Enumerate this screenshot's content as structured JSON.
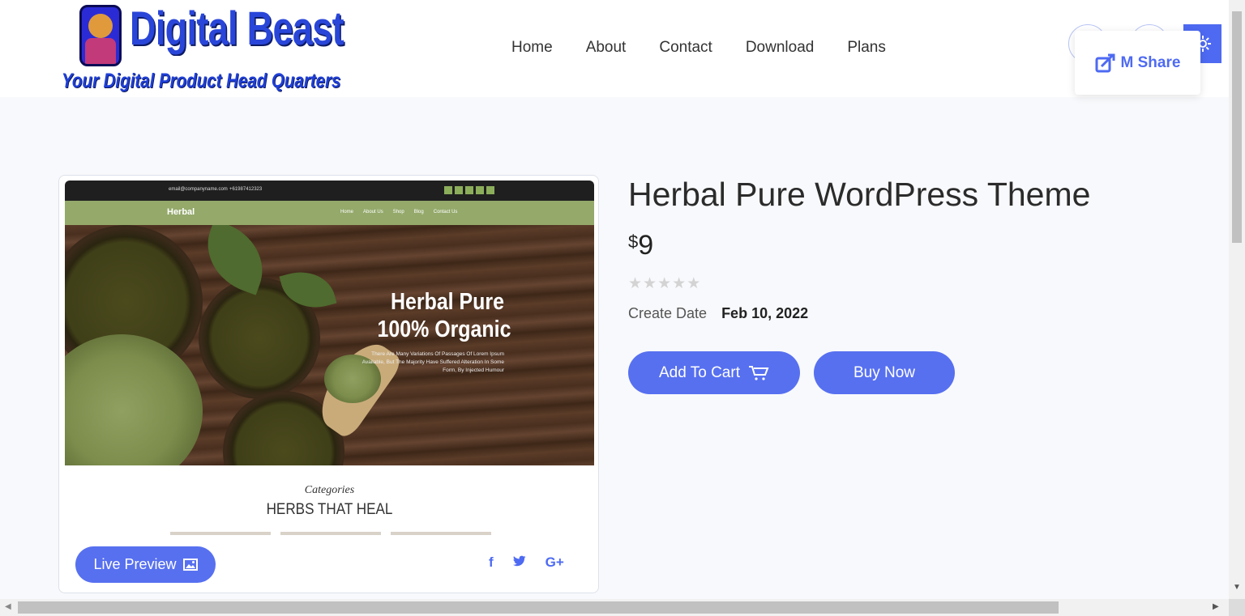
{
  "header": {
    "logo_title": "Digital Beast",
    "logo_subtitle": "Your Digital Product Head Quarters",
    "nav": [
      "Home",
      "About",
      "Contact",
      "Download",
      "Plans"
    ],
    "share_label": "M Share"
  },
  "preview": {
    "top_email": "email@companyname.com",
    "top_phone": "+61987412323",
    "brand": "Herbal",
    "nav_links": [
      "Home",
      "About Us",
      "Shop",
      "Blog",
      "Contact Us"
    ],
    "hero_title_line1": "Herbal Pure",
    "hero_title_line2": "100% Organic",
    "hero_desc": "There Are Many Variations Of Passages Of Lorem Ipsum Available, But The Majority Have Suffered Alteration In Some Form, By Injected Humour",
    "categories_script": "Categories",
    "categories_title": "HERBS THAT HEAL"
  },
  "card": {
    "live_preview_label": "Live Preview",
    "share_icons": [
      "facebook-icon",
      "twitter-icon",
      "google-plus-icon"
    ]
  },
  "product": {
    "title": "Herbal Pure WordPress Theme",
    "currency": "$",
    "price": "9",
    "rating": 0,
    "rating_max": 5,
    "create_label": "Create Date",
    "create_date": "Feb 10, 2022",
    "add_to_cart_label": "Add To Cart",
    "buy_now_label": "Buy Now"
  },
  "colors": {
    "accent": "#5770f0",
    "page_bg": "#f8f9fc"
  }
}
